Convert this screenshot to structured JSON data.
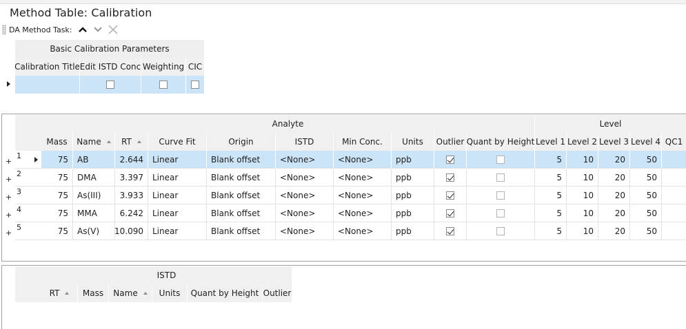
{
  "page": {
    "title": "Method Table: Calibration"
  },
  "task_bar": {
    "label": "DA Method Task:",
    "icons": [
      "chevron-up-icon",
      "chevron-down-icon",
      "close-icon"
    ]
  },
  "basic_calibration": {
    "group_title": "Basic Calibration Parameters",
    "columns": [
      "Calibration Title",
      "Edit ISTD Conc",
      "Weighting",
      "CIC"
    ],
    "row": {
      "calibration_title": "",
      "edit_istd_conc": false,
      "weighting": false,
      "cic": false
    }
  },
  "analyte_table": {
    "group_analyte": "Analyte",
    "group_level": "Level",
    "columns": {
      "mass": "Mass",
      "name": "Name",
      "rt": "RT",
      "curve_fit": "Curve Fit",
      "origin": "Origin",
      "istd": "ISTD",
      "min_conc": "Min Conc.",
      "units": "Units",
      "outlier": "Outlier",
      "quant_by_height": "Quant by Height",
      "level1": "Level 1",
      "level2": "Level 2",
      "level3": "Level 3",
      "level4": "Level 4",
      "qc1": "QC1"
    },
    "rows": [
      {
        "num": "1",
        "expander": "+",
        "mass": "75",
        "name": "AB",
        "rt": "2.644",
        "curve_fit": "Linear",
        "origin": "Blank offset",
        "istd": "<None>",
        "min_conc": "<None>",
        "units": "ppb",
        "outlier": true,
        "quant_by_height": false,
        "level1": "5",
        "level2": "10",
        "level3": "20",
        "level4": "50",
        "qc1": "",
        "selected": true
      },
      {
        "num": "2",
        "expander": "+",
        "mass": "75",
        "name": "DMA",
        "rt": "3.397",
        "curve_fit": "Linear",
        "origin": "Blank offset",
        "istd": "<None>",
        "min_conc": "<None>",
        "units": "ppb",
        "outlier": true,
        "quant_by_height": false,
        "level1": "5",
        "level2": "10",
        "level3": "20",
        "level4": "50",
        "qc1": "",
        "selected": false
      },
      {
        "num": "3",
        "expander": "+",
        "mass": "75",
        "name": "As(III)",
        "rt": "3.933",
        "curve_fit": "Linear",
        "origin": "Blank offset",
        "istd": "<None>",
        "min_conc": "<None>",
        "units": "ppb",
        "outlier": true,
        "quant_by_height": false,
        "level1": "5",
        "level2": "10",
        "level3": "20",
        "level4": "50",
        "qc1": "",
        "selected": false
      },
      {
        "num": "4",
        "expander": "+",
        "mass": "75",
        "name": "MMA",
        "rt": "6.242",
        "curve_fit": "Linear",
        "origin": "Blank offset",
        "istd": "<None>",
        "min_conc": "<None>",
        "units": "ppb",
        "outlier": true,
        "quant_by_height": false,
        "level1": "5",
        "level2": "10",
        "level3": "20",
        "level4": "50",
        "qc1": "",
        "selected": false
      },
      {
        "num": "5",
        "expander": "+",
        "mass": "75",
        "name": "As(V)",
        "rt": "10.090",
        "curve_fit": "Linear",
        "origin": "Blank offset",
        "istd": "<None>",
        "min_conc": "<None>",
        "units": "ppb",
        "outlier": true,
        "quant_by_height": false,
        "level1": "5",
        "level2": "10",
        "level3": "20",
        "level4": "50",
        "qc1": "",
        "selected": false
      }
    ]
  },
  "istd_table": {
    "group_title": "ISTD",
    "columns": {
      "rt": "RT",
      "mass": "Mass",
      "name": "Name",
      "units": "Units",
      "quant_by_height": "Quant by Height",
      "outlier": "Outlier"
    }
  },
  "colors": {
    "selected_row": "#cce4f7",
    "header_bg": "#f0f0f0",
    "grid_line": "#e2e2e2"
  }
}
